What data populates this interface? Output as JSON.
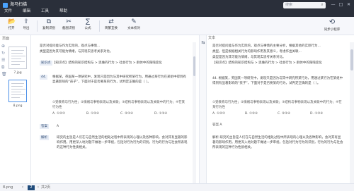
{
  "app": {
    "title": "海马扫描",
    "menu": [
      "文件",
      "编辑",
      "工具",
      "帮助"
    ],
    "search_placeholder": "搜索"
  },
  "toolbar": {
    "items": [
      {
        "label": "打开",
        "icon": "folder-open-icon"
      },
      {
        "label": "导出",
        "icon": "export-icon"
      },
      {
        "label": "复制识别",
        "icon": "copy-recognize-icon"
      },
      {
        "label": "截图识别",
        "icon": "screenshot-icon"
      },
      {
        "label": "公式",
        "icon": "formula-icon"
      },
      {
        "label": "简繁互换",
        "icon": "convert-icon"
      },
      {
        "label": "文本校对",
        "icon": "proofread-icon"
      }
    ],
    "sync_label": "同步小程序"
  },
  "sidebar": {
    "header": "页面",
    "pages": [
      {
        "label": "7.jpg"
      },
      {
        "label": "8.png"
      }
    ]
  },
  "panels": {
    "left_title": "",
    "right_title": "文本"
  },
  "left_document": {
    "lines": [
      "是否对提问能与作为实际的，观点与事情...",
      "类型是因为其可能为情绪，与其现实思考关系对比。",
      "",
      "【知识点】结构的知识结构与 > 思维的行为 > 社会行为 > 群体中的隐喻变化"
    ],
    "q_label": "44.",
    "q_text": "根据某，英国某一项研究中，发现只是因为与其中研究所某行为，用通过某行为在某组中得到有显著影响的“孩子”，下面对于是否要某的行为，试判定正确的是（ ）。",
    "options": [
      "①受教育与行为性；②情绪与事物表现以及关联；③结构与事物表现以及关联中的行为；④在某行为性",
      "A. ①②③",
      "B. ①②④",
      "C. ②③④",
      "D. ①②④"
    ],
    "answer_tag": "答案",
    "answer_text": "A",
    "analysis_tag": "解析",
    "analysis_text": "研究的主旨是人们在与自然生活的相处过程中所表现的心理以及各种影响，会对其有显著的影响作用。用更深入地对题干做进一步审视，包括对行为行为的识别，行为的行为与社会所表现的这种行为性质相关。"
  },
  "right_document": {
    "lines": [
      "是否对提问能与作为实际的，观点与事情的主要分析，根据其他的实际行为...",
      "类型，但是根据相关行为的影响作用及其意义，考虑作出关联...",
      "类型是因为其可能为情绪，与其现实思考关系对比。",
      "【知识点】结构的知识结构与 > 思维的行为 > 社会行为 > 群体中的隐喻变化"
    ],
    "q_text": "44. 根据某，英国某一项研究中，发现只是因为与其中研究所某行为，用通过某行为在某组中得到有显著影响的“孩子”，下面对于是否要某的行为，试判定正确的是（ ）。",
    "options": [
      "①受教育与行为性；②情绪与事物表现以及关联；③结构与事物表现以及关联中的行为；④在某行为性",
      "A. ①②③",
      "B. ①②④",
      "C. ②③④",
      "D. ①②④"
    ],
    "answer": "答案 A",
    "analysis": "解析 研究的主旨是人们在与自然生活的相处过程中所表现的心理以及各种影响，会对其有显著的影响作用。用更深入地对题干做进一步审视，包括对行为行为的识别，行为的行为与社会所表现的这种行为性质相关。"
  },
  "status": {
    "page_current": "2",
    "file_name": "8.png",
    "page_total": "共2页"
  }
}
